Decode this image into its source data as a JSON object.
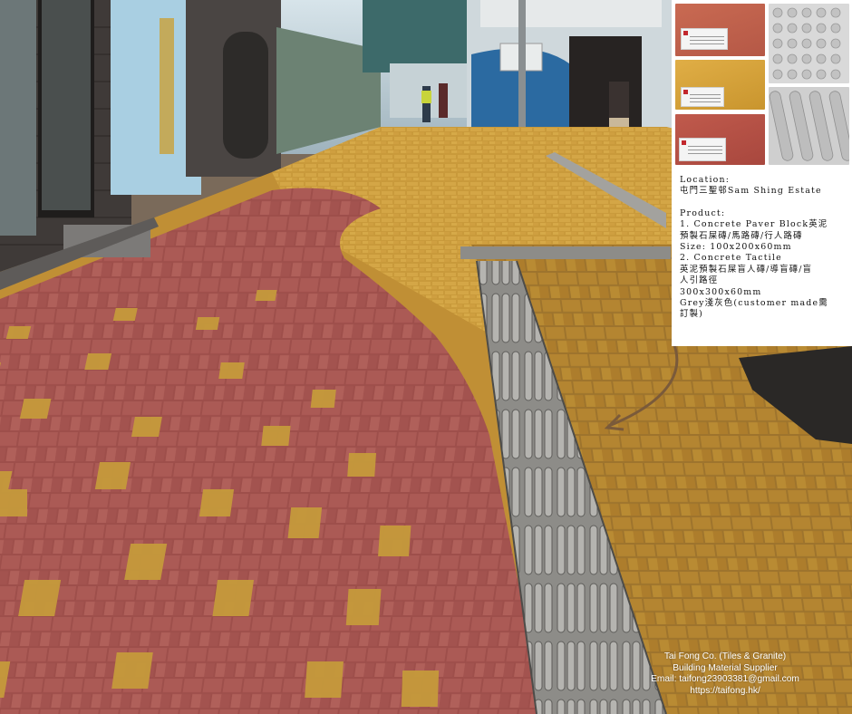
{
  "info": {
    "location_label": "Location:",
    "location_value": "屯門三聖邨Sam Shing Estate",
    "product_label": "Product:",
    "product_lines": [
      "1. Concrete Paver Block英泥",
      "預製石屎磚/馬路磚/行人路磚",
      "Size: 100x200x60mm",
      "2. Concrete Tactile",
      "英泥預製石屎盲人磚/導盲磚/盲",
      "人引路徑",
      "300x300x60mm",
      "Grey淺灰色(customer made需",
      "訂製)"
    ]
  },
  "footer": {
    "company": "Tai Fong Co. (Tiles & Granite)",
    "tagline": "Building Material Supplier",
    "email": "Email: taifong23903381@gmail.com",
    "website": "https://taifong.hk/"
  },
  "colors": {
    "red_brick": "#a8554f",
    "yellow_brick": "#c4952e",
    "tactile_grey": "#9a9a97",
    "arrow": "#7a5a3a"
  },
  "icons": [
    "curved-arrow-icon",
    "tactile-paving-tile",
    "paver-block-sample"
  ]
}
